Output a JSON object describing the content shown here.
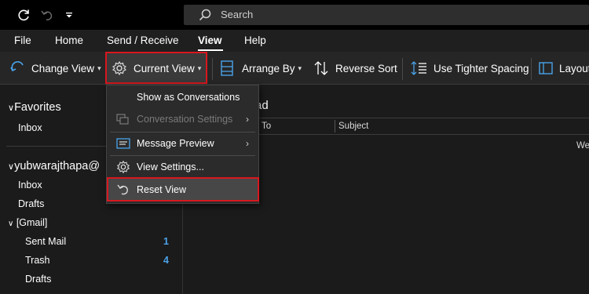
{
  "search": {
    "placeholder": "Search"
  },
  "menu": {
    "tabs": [
      "File",
      "Home",
      "Send / Receive",
      "View",
      "Help"
    ],
    "active": "View"
  },
  "ribbon": {
    "change_view": "Change View",
    "current_view": "Current View",
    "arrange_by": "Arrange By",
    "reverse_sort": "Reverse Sort",
    "use_tighter_spacing": "Use Tighter Spacing",
    "layout": "Layout"
  },
  "nav": {
    "favorites": "Favorites",
    "favorites_inbox": "Inbox",
    "account": "yubwarajthapa@",
    "inbox": "Inbox",
    "drafts": "Drafts",
    "gmail": "[Gmail]",
    "sent_mail": "Sent Mail",
    "sent_mail_count": "1",
    "trash": "Trash",
    "trash_count": "4",
    "gmail_drafts": "Drafts"
  },
  "content": {
    "title_fragment": "ad",
    "columns": [
      "To",
      "Subject"
    ],
    "row_date_fragment": "We"
  },
  "dropdown": {
    "items": [
      {
        "label": "Show as Conversations",
        "enabled": true
      },
      {
        "label": "Conversation Settings",
        "enabled": false,
        "submenu": true
      },
      {
        "label": "Message Preview",
        "enabled": true,
        "submenu": true
      },
      {
        "label": "View Settings...",
        "enabled": true
      },
      {
        "label": "Reset View",
        "enabled": true,
        "highlighted": true
      }
    ]
  },
  "colors": {
    "highlight_border": "#d8171e",
    "accent_count": "#4aa3ea",
    "background": "#1b1b1b",
    "titlebar": "#000000"
  }
}
